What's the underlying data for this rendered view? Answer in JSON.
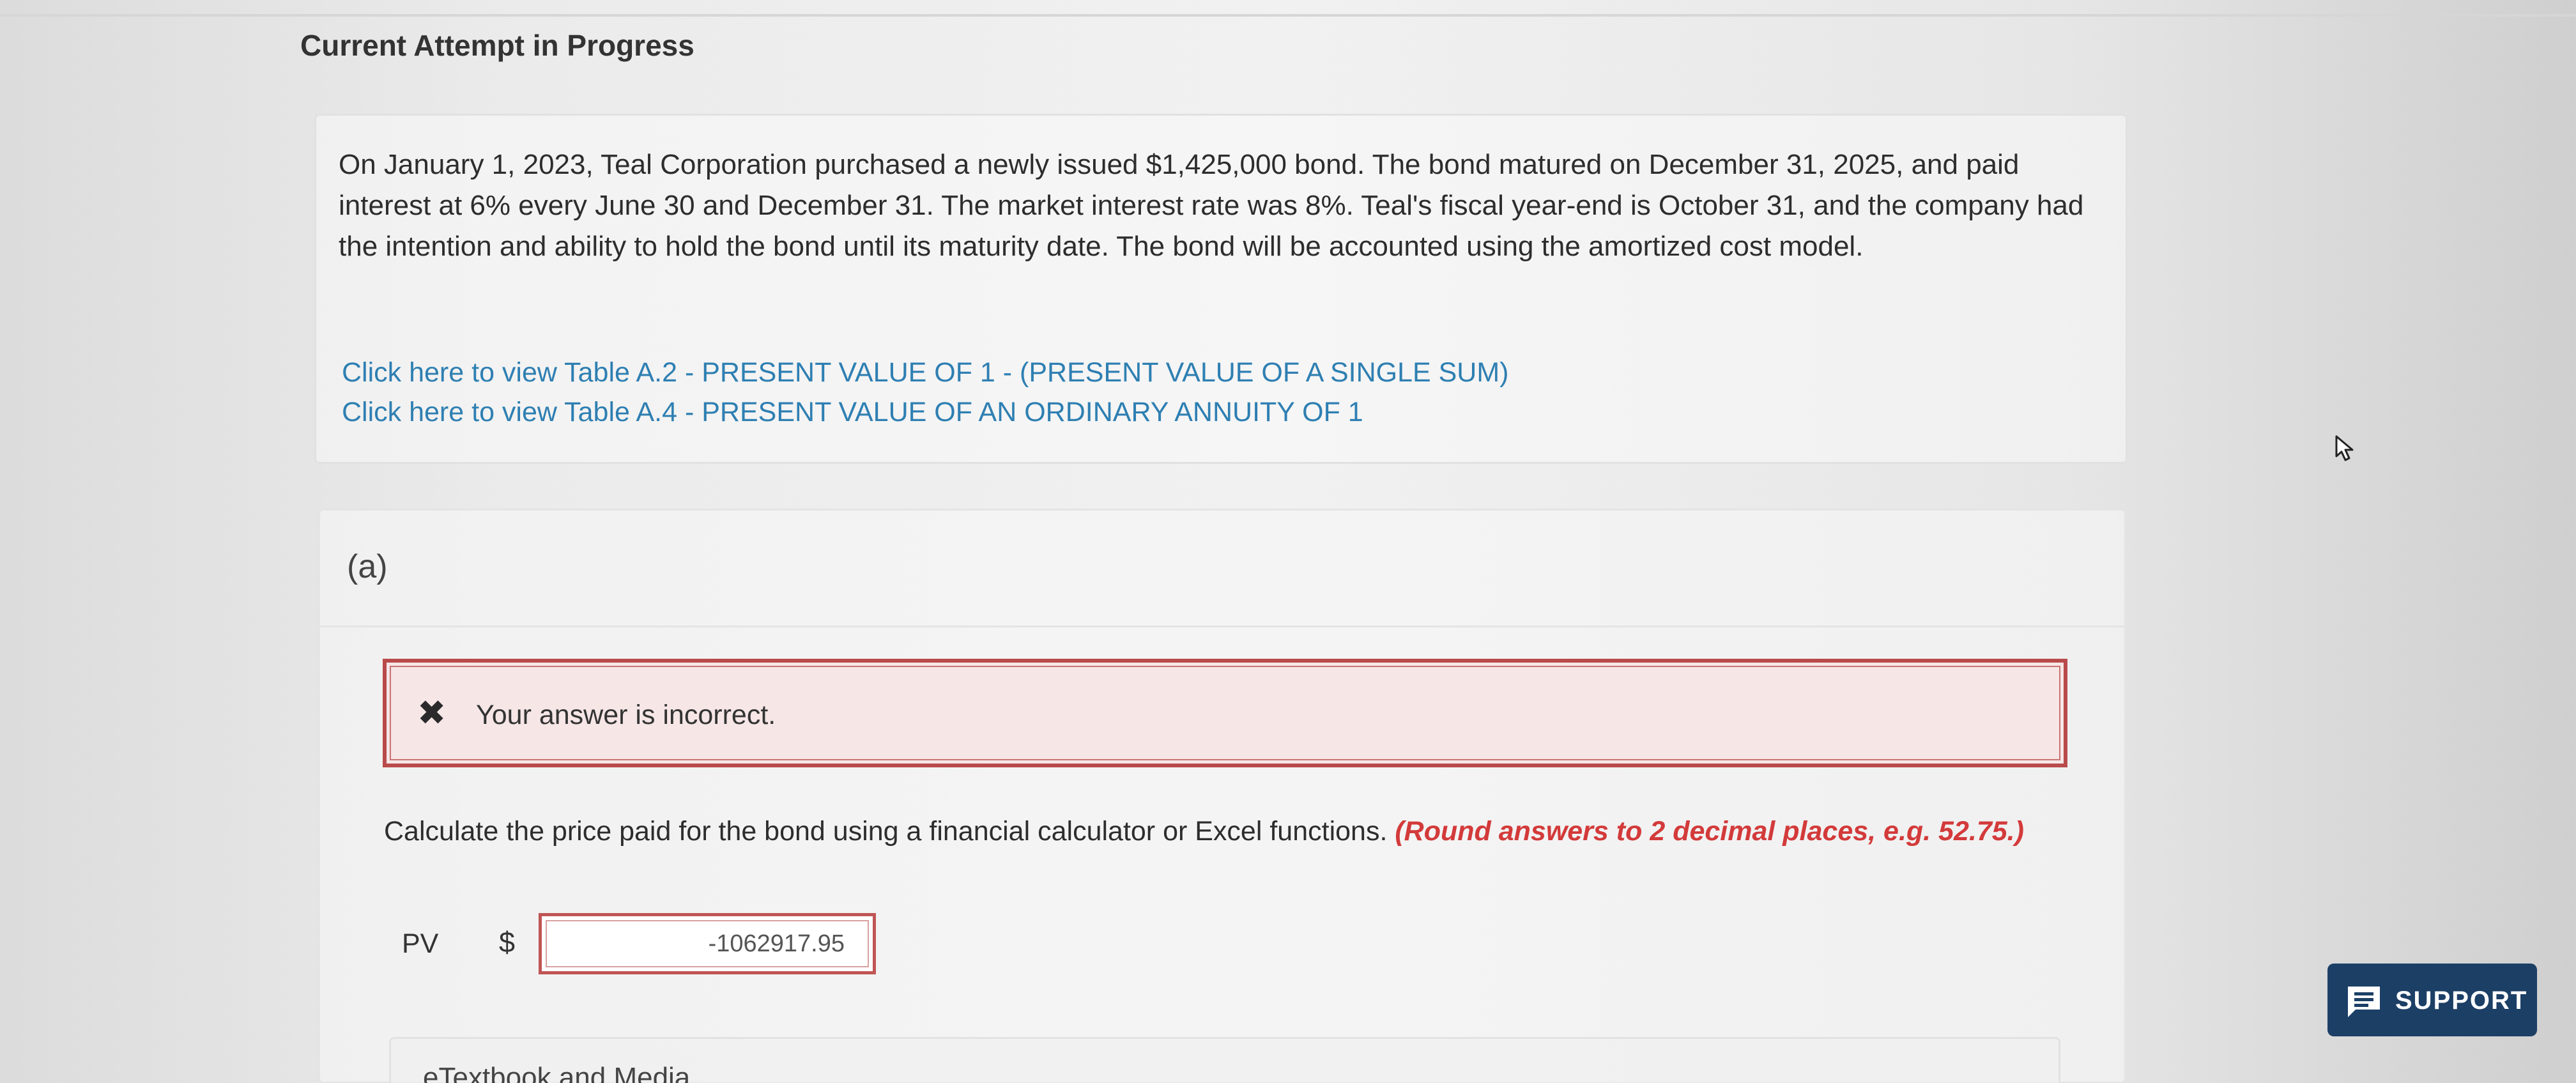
{
  "page": {
    "title": "Current Attempt in Progress"
  },
  "question": {
    "text": "On January 1, 2023, Teal Corporation purchased a newly issued $1,425,000 bond. The bond matured on December 31, 2025, and paid interest at 6% every June 30 and December 31. The market interest rate was 8%. Teal's fiscal year-end is October 31, and the company had the intention and ability to hold the bond until its maturity date. The bond will be accounted using the amortized cost model.",
    "links": [
      "Click here to view Table A.2 - PRESENT VALUE OF 1 - (PRESENT VALUE OF A SINGLE SUM)",
      "Click here to view Table A.4 - PRESENT VALUE OF AN ORDINARY ANNUITY OF 1"
    ]
  },
  "part": {
    "label": "(a)",
    "feedback": {
      "icon": "x-icon",
      "text": "Your answer is incorrect."
    },
    "instruction": "Calculate the price paid for the bond using a financial calculator or Excel functions.",
    "hint": "(Round answers to 2 decimal places, e.g. 52.75.)",
    "pv_label": "PV",
    "currency": "$",
    "pv_value": "-1062917.95",
    "next_section_partial": "eTextbook and Media"
  },
  "support": {
    "label": "SUPPORT",
    "icon": "chat-icon",
    "color": "#1c3f66"
  },
  "colors": {
    "link": "#2e7fb2",
    "error_border": "#b94a4a",
    "hint": "#d33a3a"
  }
}
